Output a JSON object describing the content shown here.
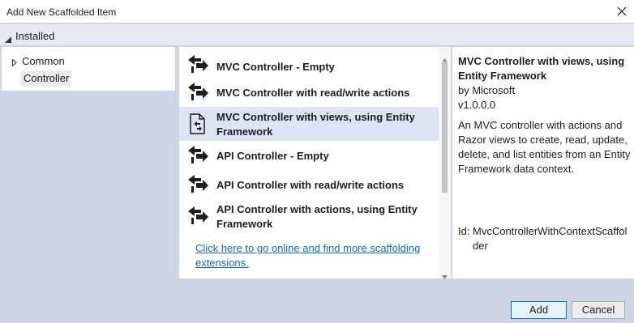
{
  "window": {
    "title": "Add New Scaffolded Item",
    "close_icon": "close-icon"
  },
  "installed": {
    "label": "Installed"
  },
  "tree": {
    "items": [
      {
        "label": "Common",
        "expandable": true
      },
      {
        "label": "Controller",
        "selected": true
      }
    ]
  },
  "templates": {
    "items": [
      {
        "label": "MVC Controller - Empty",
        "icon": "controller-icon"
      },
      {
        "label": "MVC Controller with read/write actions",
        "icon": "controller-icon"
      },
      {
        "label": "MVC Controller with views, using Entity Framework",
        "icon": "controller-views-icon",
        "selected": true
      },
      {
        "label": "API Controller - Empty",
        "icon": "controller-icon"
      },
      {
        "label": "API Controller with read/write actions",
        "icon": "controller-icon"
      },
      {
        "label": "API Controller with actions, using Entity Framework",
        "icon": "controller-icon"
      }
    ],
    "online_link": "Click here to go online and find more scaffolding extensions."
  },
  "details": {
    "title": "MVC Controller with views, using Entity Framework",
    "author": "by Microsoft",
    "version": "v1.0.0.0",
    "description": "An MVC controller with actions and Razor views to create, read, update, delete, and list entities from an Entity Framework data context.",
    "id_label": "Id:",
    "id_value": "MvcControllerWithContextScaffolder"
  },
  "buttons": {
    "add": "Add",
    "cancel": "Cancel"
  },
  "colors": {
    "dialog_bg": "#ced4e4",
    "selected_bg": "#dde3f3",
    "link": "#0e70c0"
  }
}
